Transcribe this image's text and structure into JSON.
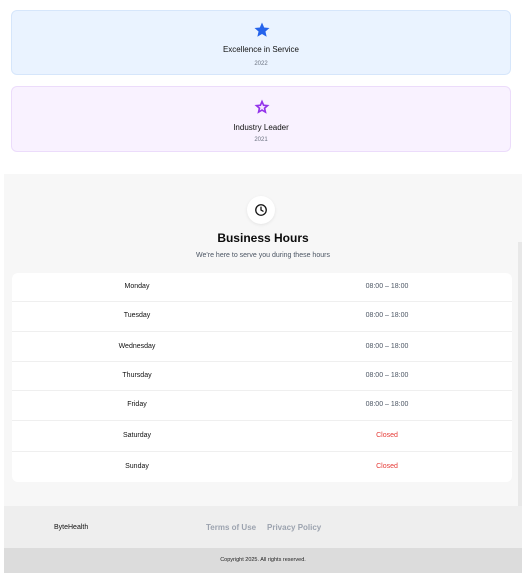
{
  "awards": [
    {
      "title": "Excellence in Service",
      "year": "2022",
      "icon": "star-icon",
      "color": "#2563eb"
    },
    {
      "title": "Industry Leader",
      "year": "2021",
      "icon": "award-star-icon",
      "color": "#9333ea"
    }
  ],
  "hours": {
    "title": "Business Hours",
    "subtitle": "We're here to serve you during these hours",
    "icon": "clock-icon",
    "closed_color": "#e53935",
    "rows": [
      {
        "day": "Monday",
        "time": "08:00 – 18:00"
      },
      {
        "day": "Tuesday",
        "time": "08:00 – 18:00"
      },
      {
        "day": "Wednesday",
        "time": "08:00 – 18:00"
      },
      {
        "day": "Thursday",
        "time": "08:00 – 18:00"
      },
      {
        "day": "Friday",
        "time": "08:00 – 18:00"
      },
      {
        "day": "Saturday",
        "time": "Closed"
      },
      {
        "day": "Sunday",
        "time": "Closed"
      }
    ]
  },
  "footer": {
    "brand": "ByteHealth",
    "links": [
      "Terms of Use",
      "Privacy Policy"
    ],
    "copyright": "Copyright 2025. All rights reserved."
  }
}
